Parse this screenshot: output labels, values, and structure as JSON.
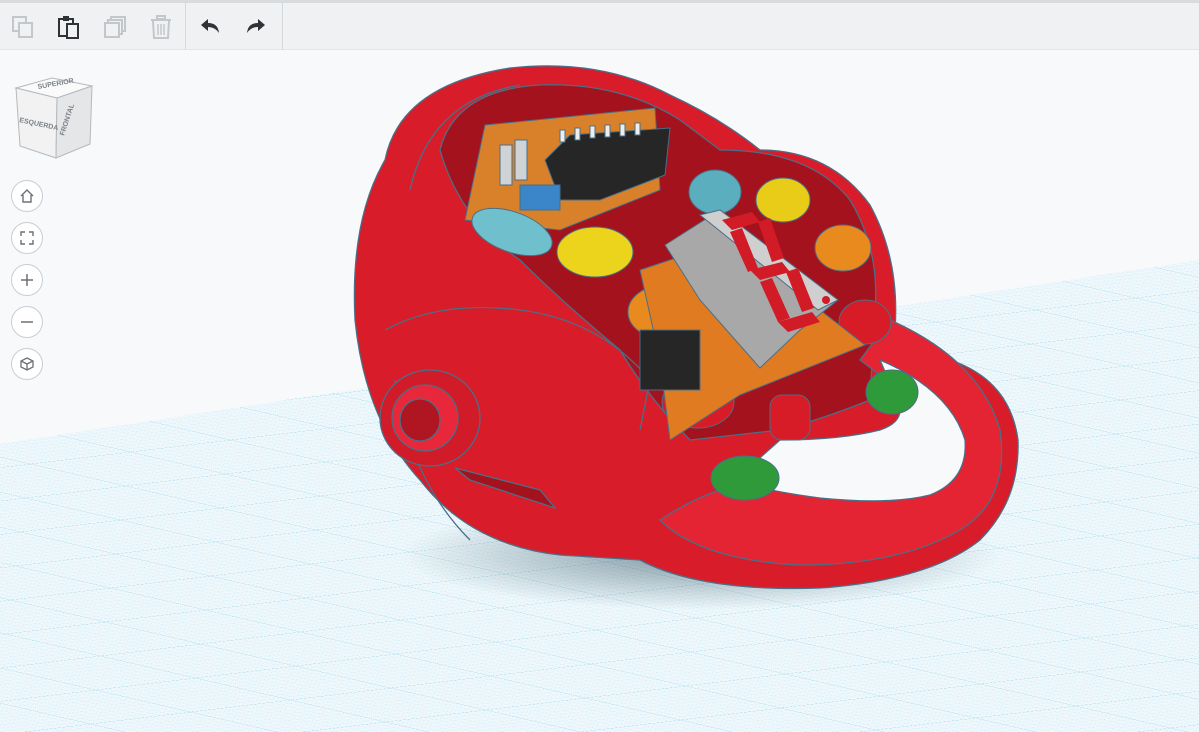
{
  "toolbar": {
    "items": [
      {
        "name": "copy",
        "icon": "copy-icon",
        "enabled": false
      },
      {
        "name": "paste",
        "icon": "paste-icon",
        "enabled": true
      },
      {
        "name": "duplicate",
        "icon": "duplicate-icon",
        "enabled": false
      },
      {
        "name": "delete",
        "icon": "trash-icon",
        "enabled": false
      },
      {
        "name": "undo",
        "icon": "undo-icon",
        "enabled": true
      },
      {
        "name": "redo",
        "icon": "redo-icon",
        "enabled": true
      }
    ]
  },
  "viewcube": {
    "left_face": "ESQUERDA",
    "front_face": "FRONTAL",
    "top_face": "SUPERIOR"
  },
  "nav_controls": [
    "home-icon",
    "fit-icon",
    "zoom-in-icon",
    "zoom-out-icon",
    "perspective-icon"
  ],
  "colors": {
    "grid_line": "#bfe3f0",
    "grid_major": "#8fcde3",
    "model_red": "#e0202f",
    "model_dark": "#a30f1a",
    "outline": "#4a6f86"
  }
}
